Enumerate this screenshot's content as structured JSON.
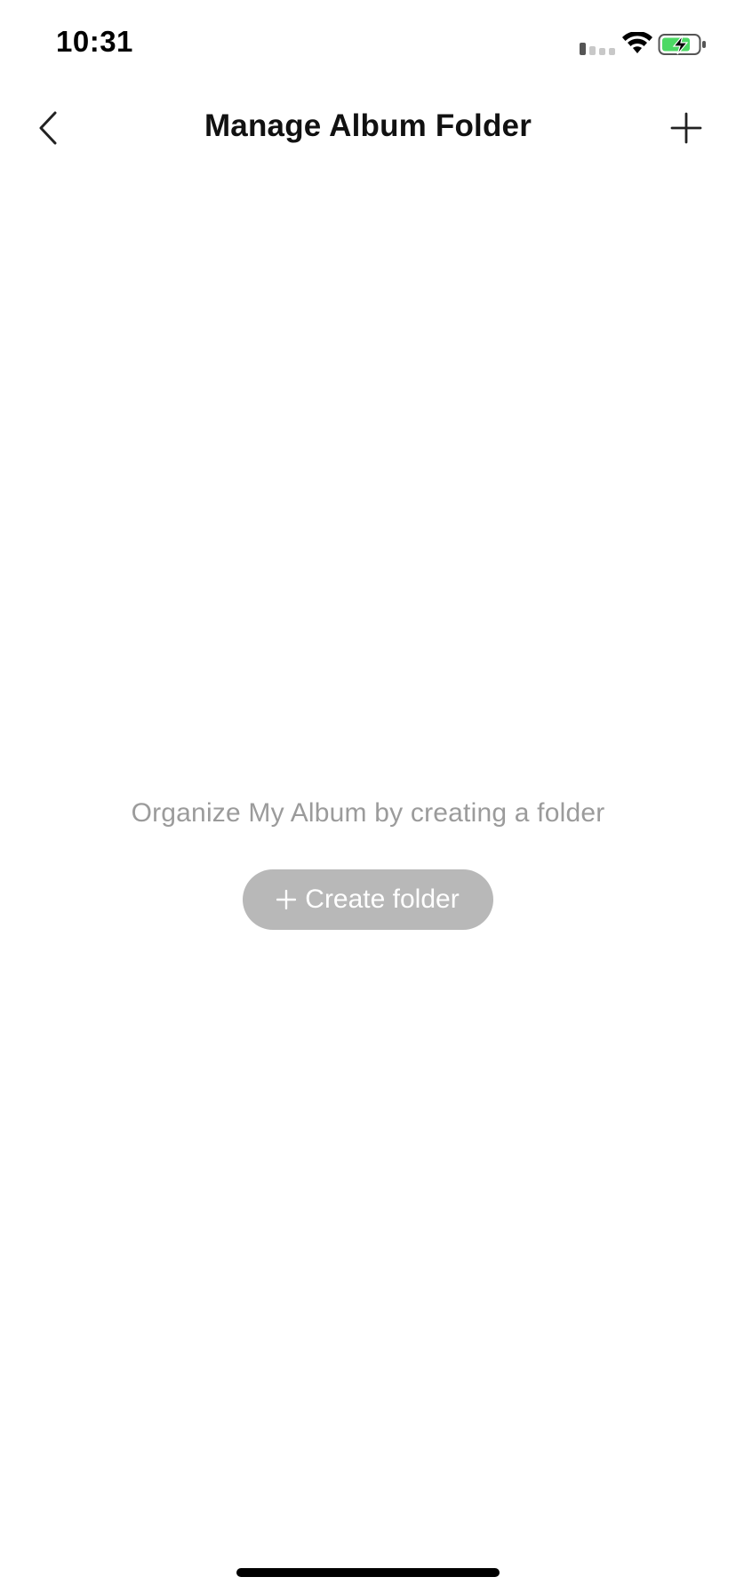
{
  "status_bar": {
    "time": "10:31",
    "icons": [
      "signal-icon",
      "wifi-icon",
      "battery-charging-icon"
    ],
    "battery_color": "#4cd964"
  },
  "nav": {
    "title": "Manage Album Folder",
    "back_icon": "chevron-left-icon",
    "add_icon": "plus-icon"
  },
  "empty_state": {
    "message": "Organize My Album by creating a folder",
    "button_label": "Create folder",
    "button_icon": "plus-icon",
    "button_color": "#b8b8b8",
    "message_color": "#9b9b9b"
  }
}
